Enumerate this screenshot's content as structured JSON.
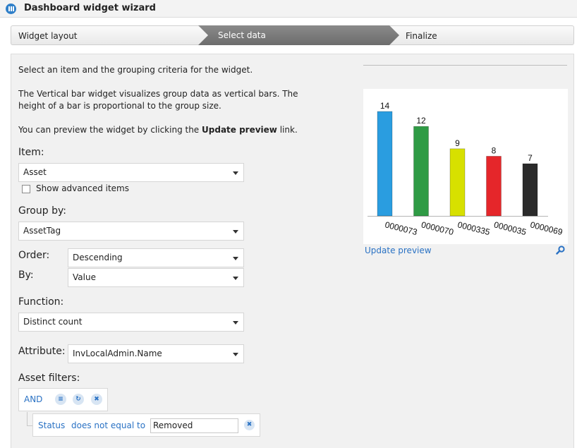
{
  "window": {
    "title": "Dashboard widget wizard"
  },
  "steps": [
    {
      "label": "Widget layout"
    },
    {
      "label": "Select data"
    },
    {
      "label": "Finalize"
    }
  ],
  "intro": {
    "line1": "Select an item and the grouping criteria for the widget.",
    "line2": "The Vertical bar widget visualizes group data as vertical bars. The",
    "line3": "height of a bar is proportional to the group size.",
    "line4_pre": "You can preview the widget by clicking the ",
    "line4_bold": "Update preview",
    "line4_post": " link."
  },
  "form": {
    "item_label": "Item:",
    "item_value": "Asset",
    "advanced_label": "Show advanced items",
    "groupby_label": "Group by:",
    "groupby_value": "AssetTag",
    "order_label": "Order:",
    "order_value": "Descending",
    "by_label": "By:",
    "by_value": "Value",
    "function_label": "Function:",
    "function_value": "Distinct count",
    "attribute_label": "Attribute:",
    "attribute_value": "InvLocalAdmin.Name",
    "filters_label": "Asset filters:"
  },
  "filters": {
    "operator": "AND",
    "condition": {
      "field": "Status",
      "comparison": "does not equal to",
      "value": "Removed"
    }
  },
  "preview": {
    "update_link": "Update preview"
  },
  "colors": {
    "link": "#2a72c4",
    "active_step": "#777777"
  },
  "chart_data": {
    "type": "bar",
    "categories": [
      "0000073",
      "0000070",
      "0000335",
      "0000035",
      "0000069"
    ],
    "values": [
      14,
      12,
      9,
      8,
      7
    ],
    "colors": [
      "#2a9de0",
      "#2f9b45",
      "#d7e000",
      "#e5262a",
      "#2b2b2b"
    ],
    "title": "",
    "xlabel": "",
    "ylabel": "",
    "ylim": [
      0,
      14
    ]
  }
}
